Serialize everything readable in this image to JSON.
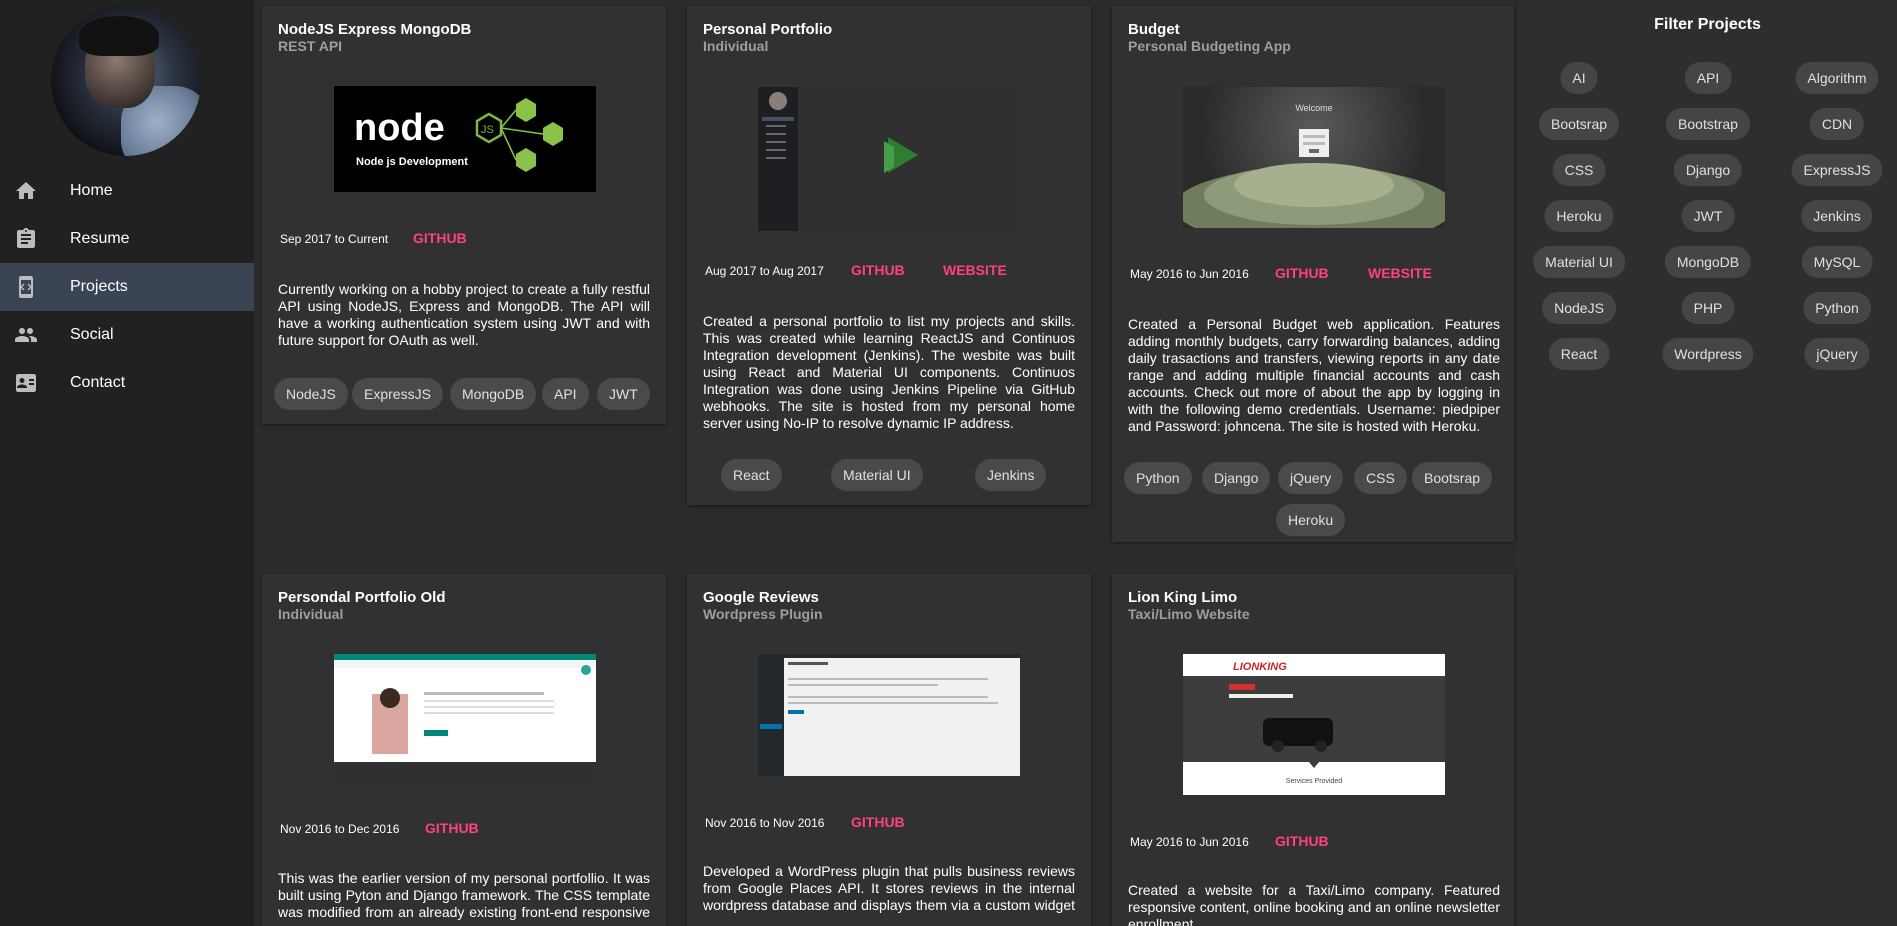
{
  "nav": [
    {
      "label": "Home",
      "icon": "home-icon"
    },
    {
      "label": "Resume",
      "icon": "clipboard-icon"
    },
    {
      "label": "Projects",
      "icon": "developer-board-icon"
    },
    {
      "label": "Social",
      "icon": "people-icon"
    },
    {
      "label": "Contact",
      "icon": "contact-card-icon"
    }
  ],
  "projects": [
    {
      "title": "NodeJS Express MongoDB",
      "subtitle": "REST API",
      "image_text": "Node js Development",
      "date": "Sep 2017 to Current",
      "links": [
        "GITHUB"
      ],
      "description": "Currently working on a hobby project to create a fully restful API using NodeJS, Express and MongoDB. The API will have a working authentication system using JWT and with future support for OAuth as well.",
      "tags": [
        "NodeJS",
        "ExpressJS",
        "MongoDB",
        "API",
        "JWT"
      ]
    },
    {
      "title": "Personal Portfolio",
      "subtitle": "Individual",
      "date": "Aug 2017 to Aug 2017",
      "links": [
        "GITHUB",
        "WEBSITE"
      ],
      "description": "Created a personal portfolio to list my projects and skills. This was created while learning ReactJS and Continuos Integration development (Jenkins). The wesbite was built using React and Material UI components. Continuos Integration was done using Jenkins Pipeline via GitHub webhooks. The site is hosted from my personal home server using No-IP to resolve dynamic IP address.",
      "tags": [
        "React",
        "Material UI",
        "Jenkins"
      ]
    },
    {
      "title": "Budget",
      "subtitle": "Personal Budgeting App",
      "image_text": "Welcome",
      "date": "May 2016 to Jun 2016",
      "links": [
        "GITHUB",
        "WEBSITE"
      ],
      "description": "Created a Personal Budget web application. Features adding monthly budgets, carry forwarding balances, adding daily trasactions and transfers, viewing reports in any date range and adding multiple financial accounts and cash accounts. Check out more of about the app by logging in with the following demo credentials. Username: piedpiper and Password: johncena. The site is hosted with Heroku.",
      "tags": [
        "Python",
        "Django",
        "jQuery",
        "CSS",
        "Bootsrap",
        "Heroku"
      ]
    },
    {
      "title": "Persondal Portfolio Old",
      "subtitle": "Individual",
      "date": "Nov 2016 to Dec 2016",
      "links": [
        "GITHUB"
      ],
      "description": "This was the earlier version of my personal portfollio. It was built using Pyton and Django framework. The CSS template was modified from an already existing front-end responsive theme. All the content in the website was served through"
    },
    {
      "title": "Google Reviews",
      "subtitle": "Wordpress Plugin",
      "date": "Nov 2016 to Nov 2016",
      "links": [
        "GITHUB"
      ],
      "description": "Developed a WordPress plugin that pulls business reviews from Google Places API. It stores reviews in the internal wordpress database and displays them via a custom widget or a shortcode. The plugin will listen for updates from the"
    },
    {
      "title": "Lion King Limo",
      "subtitle": "Taxi/Limo Website",
      "image_text": "Services Provided",
      "date": "May 2016 to Jun 2016",
      "links": [
        "GITHUB"
      ],
      "description": "Created a website for a Taxi/Limo company. Featured responsive content, online booking and an online newsletter enrollment."
    }
  ],
  "filter": {
    "title": "Filter Projects",
    "tags": [
      "AI",
      "API",
      "Algorithm",
      "Bootsrap",
      "Bootstrap",
      "CDN",
      "CSS",
      "Django",
      "ExpressJS",
      "Heroku",
      "JWT",
      "Jenkins",
      "Material UI",
      "MongoDB",
      "MySQL",
      "NodeJS",
      "PHP",
      "Python",
      "React",
      "Wordpress",
      "jQuery"
    ]
  },
  "colors": {
    "accent": "#ff4081",
    "sidebar": "#212121",
    "active_nav": "#3a4452",
    "card": "#313131",
    "chip": "#4a4a4a"
  }
}
